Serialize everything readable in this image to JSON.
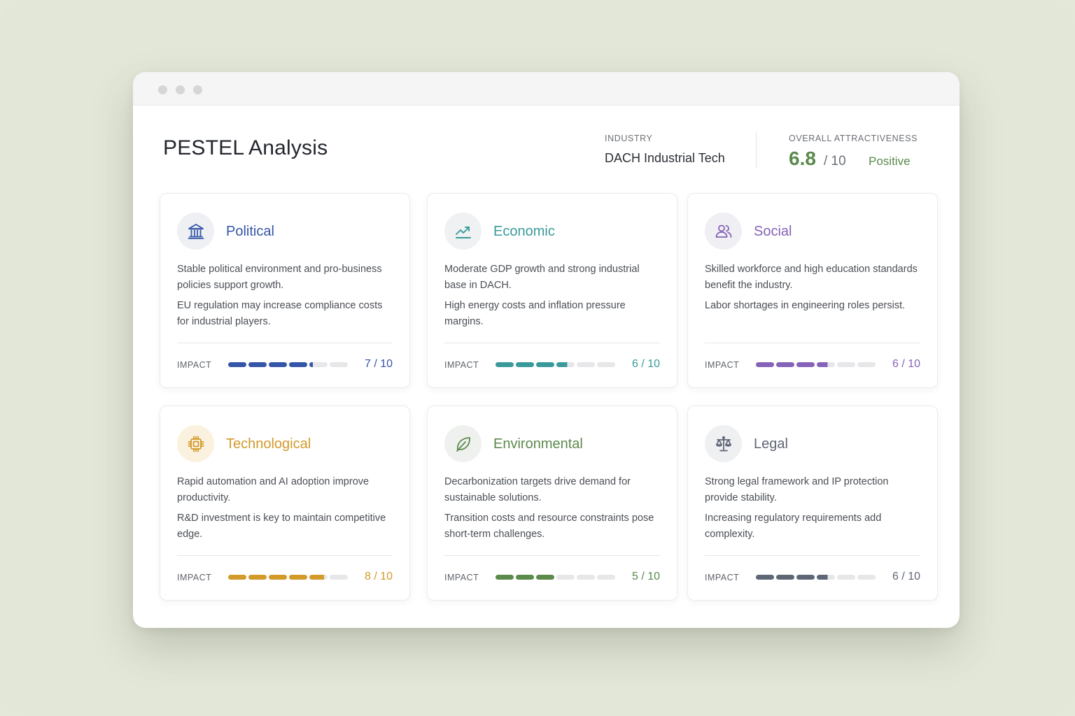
{
  "header": {
    "title": "PESTEL Analysis",
    "industry_label": "INDUSTRY",
    "industry_value": "DACH Industrial Tech",
    "overall_label": "OVERALL ATTRACTIVENESS",
    "overall_score": "6.8",
    "overall_max": "/ 10",
    "overall_status": "Positive",
    "score_color": "#5b8a4b"
  },
  "impact_label": "IMPACT",
  "cards": [
    {
      "key": "political",
      "title": "Political",
      "icon": "government-building-icon",
      "color": "#3556a8",
      "icon_bg": "#eef0f4",
      "text1": "Stable political environment and pro-business policies support growth.",
      "text2": "EU regulation may increase compliance costs for industrial players.",
      "impact": 7,
      "impact_text": "7 / 10"
    },
    {
      "key": "economic",
      "title": "Economic",
      "icon": "trend-up-chart-icon",
      "color": "#3a9a9a",
      "icon_bg": "#eff1f2",
      "text1": "Moderate GDP growth and strong industrial base in DACH.",
      "text2": "High energy costs and inflation pressure margins.",
      "impact": 6,
      "impact_text": "6 / 10"
    },
    {
      "key": "social",
      "title": "Social",
      "icon": "people-icon",
      "color": "#8663b8",
      "icon_bg": "#f0eff4",
      "text1": "Skilled workforce and high education standards benefit the industry.",
      "text2": "Labor shortages in engineering roles persist.",
      "impact": 6,
      "impact_text": "6 / 10"
    },
    {
      "key": "technological",
      "title": "Technological",
      "icon": "microchip-icon",
      "color": "#d39a2a",
      "icon_bg": "#fbf1df",
      "text1": "Rapid automation and AI adoption improve productivity.",
      "text2": "R&D investment is key to maintain competitive edge.",
      "impact": 8,
      "impact_text": "8 / 10"
    },
    {
      "key": "environmental",
      "title": "Environmental",
      "icon": "leaf-icon",
      "color": "#5b8a4b",
      "icon_bg": "#eff1ef",
      "text1": "Decarbonization targets drive demand for sustainable solutions.",
      "text2": "Transition costs and resource constraints pose short-term challenges.",
      "impact": 5,
      "impact_text": "5 / 10"
    },
    {
      "key": "legal",
      "title": "Legal",
      "icon": "scales-icon",
      "color": "#5f6675",
      "icon_bg": "#eff0f2",
      "text1": "Strong legal framework and IP protection provide stability.",
      "text2": "Increasing regulatory requirements add complexity.",
      "impact": 6,
      "impact_text": "6 / 10"
    }
  ]
}
